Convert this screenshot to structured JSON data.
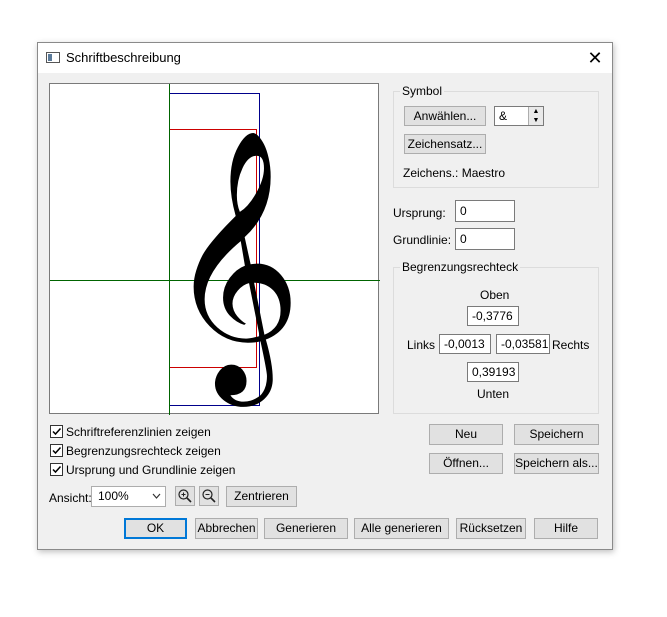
{
  "window": {
    "title": "Schriftbeschreibung",
    "close_glyph": "✕"
  },
  "symbol_group": {
    "label": "Symbol",
    "select_button": "Anwählen...",
    "char_value": "&",
    "charset_button": "Zeichensatz...",
    "charset_info": "Zeichens.: Maestro",
    "glyph": "𝄞"
  },
  "origin": {
    "label": "Ursprung:",
    "value": "0"
  },
  "baseline": {
    "label": "Grundlinie:",
    "value": "0"
  },
  "bbox_group": {
    "label": "Begrenzungsrechteck",
    "top_label": "Oben",
    "top_value": "-0,3776",
    "left_label": "Links",
    "left_value": "-0,0013",
    "right_value": "-0,03581",
    "right_label": "Rechts",
    "bottom_value": "0,39193",
    "bottom_label": "Unten"
  },
  "checkboxes": [
    {
      "label": "Schriftreferenzlinien zeigen",
      "checked": true
    },
    {
      "label": "Begrenzungsrechteck zeigen",
      "checked": true
    },
    {
      "label": "Ursprung und Grundlinie zeigen",
      "checked": true
    }
  ],
  "file_buttons": {
    "new": "Neu",
    "save": "Speichern",
    "open": "Öffnen...",
    "save_as": "Speichern als..."
  },
  "view": {
    "label": "Ansicht:",
    "zoom": "100%",
    "center_button": "Zentrieren"
  },
  "footer": {
    "ok": "OK",
    "cancel": "Abbrechen",
    "generate": "Generieren",
    "generate_all": "Alle generieren",
    "reset": "Rücksetzen",
    "help": "Hilfe"
  },
  "colors": {
    "reference_lines": "#00008b",
    "bounding_box": "#cc0000",
    "origin_lines": "#006400",
    "accent": "#0078d7"
  }
}
